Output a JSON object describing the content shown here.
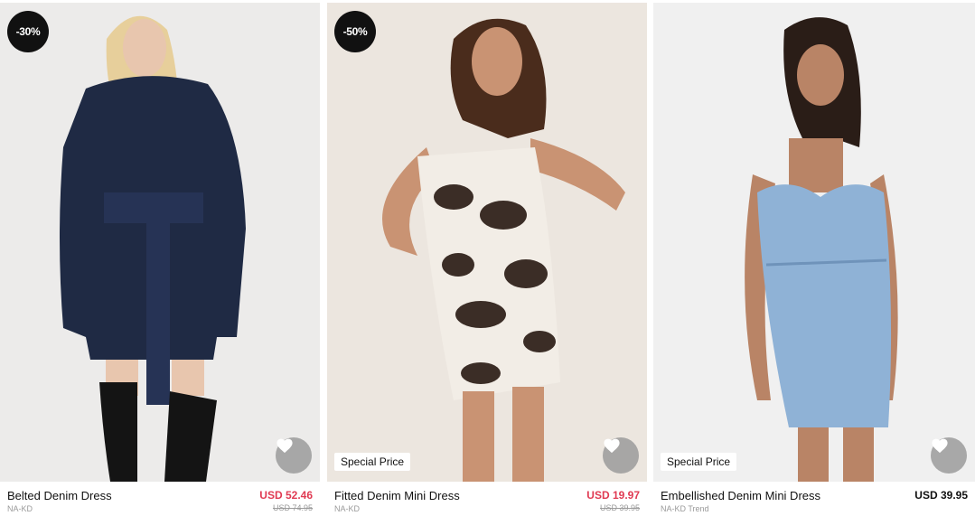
{
  "products": [
    {
      "name": "Belted Denim Dress",
      "brand": "NA-KD",
      "price": "USD 52.46",
      "old_price": "USD 74.95",
      "discount": "-30%",
      "tag": "",
      "bg_color": "#ecebea",
      "garment_color": "#1f2a44"
    },
    {
      "name": "Fitted Denim Mini Dress",
      "brand": "NA-KD",
      "price": "USD 19.97",
      "old_price": "USD 39.95",
      "discount": "-50%",
      "tag": "Special Price",
      "bg_color": "#ece6df",
      "garment_color": "#f2ede6"
    },
    {
      "name": "Embellished Denim Mini Dress",
      "brand": "NA-KD Trend",
      "price": "USD 39.95",
      "old_price": "",
      "discount": "",
      "tag": "Special Price",
      "bg_color": "#f0f0f0",
      "garment_color": "#8fb2d6"
    }
  ],
  "colors": {
    "sale": "#e03a52",
    "badge": "#111111",
    "muted": "#9a9a9a"
  },
  "icons": {
    "favorite": "heart-icon"
  }
}
